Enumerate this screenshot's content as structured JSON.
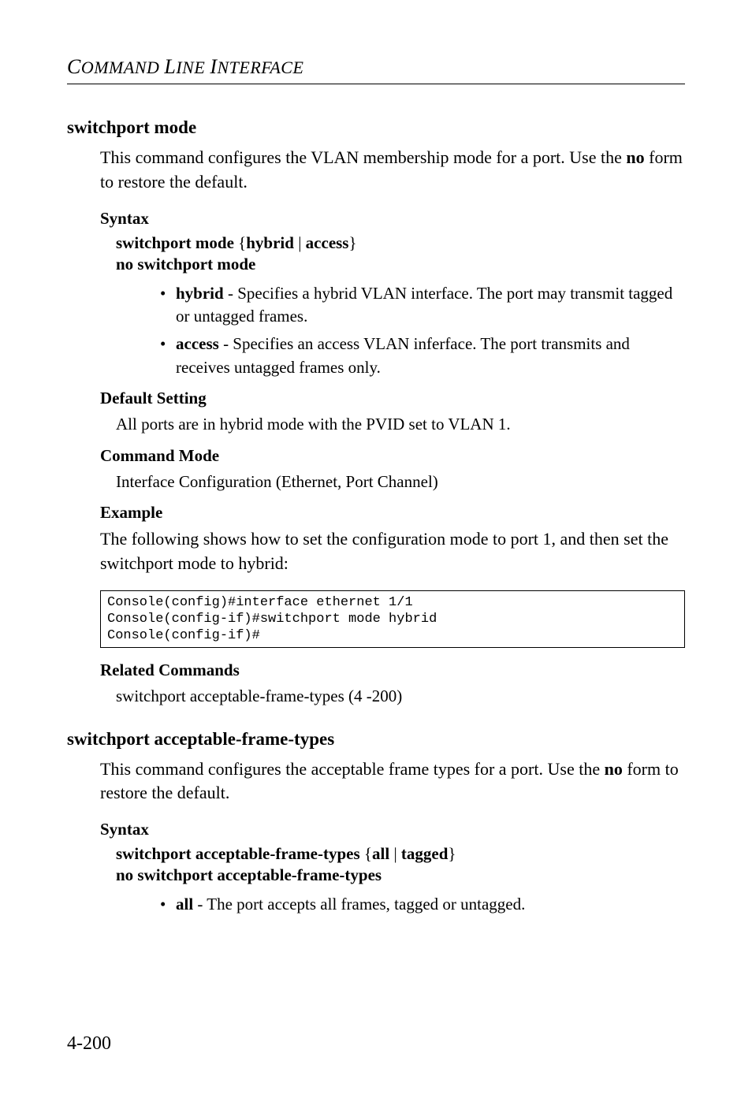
{
  "header": {
    "title_html": "C<span class='sm'>OMMAND</span> L<span class='sm'>INE</span> I<span class='sm'>NTERFACE</span>",
    "title": "COMMAND LINE INTERFACE"
  },
  "sections": [
    {
      "name": "switchport mode",
      "intro": "This command configures the VLAN membership mode for a port. Use the ",
      "intro_bold": "no",
      "intro_after": " form to restore the default.",
      "syntax_label": "Syntax",
      "syntax_lines": [
        {
          "parts": [
            "<b>switchport mode</b> {<b>hybrid</b> | <b>access</b>}"
          ]
        },
        {
          "parts": [
            "<b>no switchport mode</b>"
          ]
        }
      ],
      "bullets": [
        {
          "bold": "hybrid",
          "text": " - Specifies a hybrid VLAN interface. The port may transmit tagged or untagged frames."
        },
        {
          "bold": "access",
          "text": " - Specifies an access VLAN inferface. The port transmits and receives untagged frames only."
        }
      ],
      "default_label": "Default Setting",
      "default_text": "All ports are in hybrid mode with the PVID set to VLAN 1.",
      "mode_label": "Command Mode",
      "mode_text": "Interface Configuration (Ethernet, Port Channel)",
      "example_label": "Example",
      "example_intro": "The following shows how to set the configuration mode to port 1, and then set the switchport mode to hybrid:",
      "code": "Console(config)#interface ethernet 1/1\nConsole(config-if)#switchport mode hybrid\nConsole(config-if)#",
      "related_label": "Related Commands",
      "related_text": "switchport acceptable-frame-types (4 -200)"
    },
    {
      "name": "switchport acceptable-frame-types",
      "intro": "This command configures the acceptable frame types for a port. Use the ",
      "intro_bold": "no",
      "intro_after": " form to restore the default.",
      "syntax_label": "Syntax",
      "syntax_lines": [
        {
          "parts": [
            "<b>switchport acceptable-frame-types</b> {<b>all</b> | <b>tagged</b>}"
          ]
        },
        {
          "parts": [
            "<b>no switchport acceptable-frame-types</b>"
          ]
        }
      ],
      "bullets": [
        {
          "bold": "all",
          "text": " - The port accepts all frames, tagged or untagged."
        }
      ]
    }
  ],
  "page_number": "4-200"
}
